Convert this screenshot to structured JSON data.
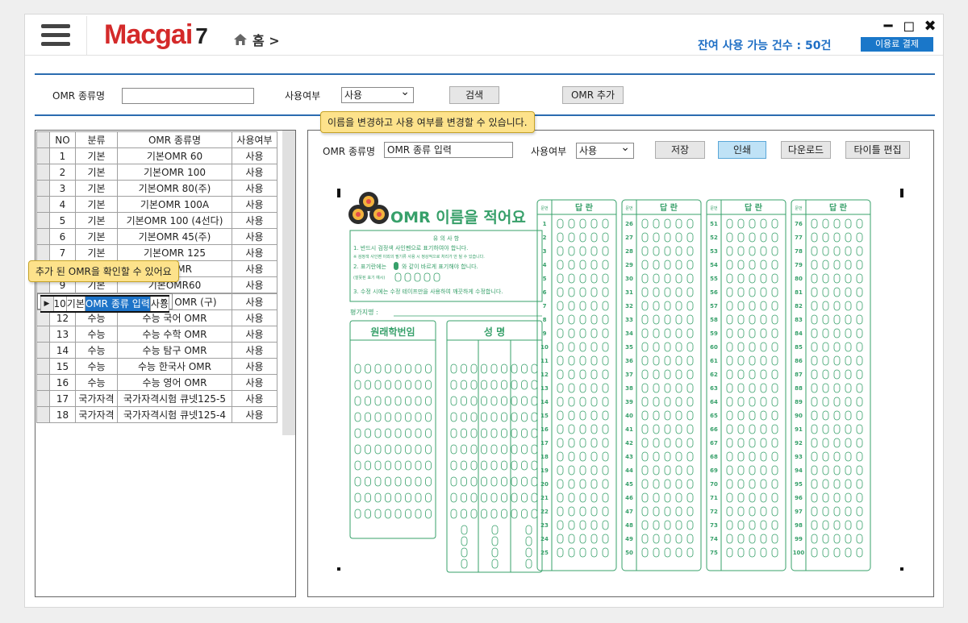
{
  "header": {
    "logo_main": "Macgai",
    "logo_num": "7",
    "breadcrumb": "홈 >",
    "remaining": "잔여 사용 가능 건수 : 50건",
    "pay_button": "이용료 결제"
  },
  "window_controls": {
    "min": "━",
    "max": "◻",
    "close": "✖"
  },
  "search": {
    "name_label": "OMR 종류명",
    "name_value": "",
    "use_label": "사용여부",
    "use_value": "사용",
    "search_button": "검색",
    "add_button": "OMR 추가"
  },
  "table": {
    "headers": [
      "NO",
      "분류",
      "OMR 종류명",
      "사용여부"
    ],
    "rows": [
      [
        "1",
        "기본",
        "기본OMR 60",
        "사용"
      ],
      [
        "2",
        "기본",
        "기본OMR 100",
        "사용"
      ],
      [
        "3",
        "기본",
        "기본OMR 80(주)",
        "사용"
      ],
      [
        "4",
        "기본",
        "기본OMR 100A",
        "사용"
      ],
      [
        "5",
        "기본",
        "기본OMR 100 (4선다)",
        "사용"
      ],
      [
        "6",
        "기본",
        "기본OMR 45(주)",
        "사용"
      ],
      [
        "7",
        "기본",
        "기본OMR 125",
        "사용"
      ],
      [
        "8",
        "기본",
        "한 OMR",
        "사용"
      ],
      [
        "9",
        "기본",
        "기본OMR60",
        "사용"
      ],
      [
        "10",
        "기본",
        "OMR 종류 입력",
        "사용"
      ],
      [
        "11",
        "수능",
        "수능 수학 OMR (구)",
        "사용"
      ],
      [
        "12",
        "수능",
        "수능 국어 OMR",
        "사용"
      ],
      [
        "13",
        "수능",
        "수능 수학 OMR",
        "사용"
      ],
      [
        "14",
        "수능",
        "수능 탐구 OMR",
        "사용"
      ],
      [
        "15",
        "수능",
        "수능 한국사 OMR",
        "사용"
      ],
      [
        "16",
        "수능",
        "수능 영어 OMR",
        "사용"
      ],
      [
        "17",
        "국가자격",
        "국가자격시험 큐넷125-5",
        "사용"
      ],
      [
        "18",
        "국가자격",
        "국가자격시험 큐넷125-4",
        "사용"
      ]
    ],
    "selected_row_marker": "▶"
  },
  "editor": {
    "name_label": "OMR 종류명",
    "name_value": "OMR 종류 입력",
    "use_label": "사용여부",
    "use_value": "사용",
    "save_button": "저장",
    "print_button": "인쇄",
    "download_button": "다운로드",
    "title_edit_button": "타이틀 편집"
  },
  "tooltips": {
    "top": "이름을 변경하고 사용 여부를 변경할 수 있습니다.",
    "left": "추가 된 OMR을 확인할 수 있어요"
  },
  "omr_sheet": {
    "title": "OMR 이름을 적어요",
    "notice_title": "유 의 사 항",
    "notice_1": "1. 반드시 검정색 사인펜으로 표기하여야 합니다.",
    "notice_1b": "※ 검정색 사인펜 이외의 필기류 사용 시 정상적으로 처리가 안 될 수 있습니다.",
    "notice_2a": "2. 표기란에는",
    "notice_2b": "와 같이 바르게 표기해야 합니다.",
    "notice_2c": "(잘못된 표기 예시)",
    "notice_3": "3. 수정 시에는 수정 테이프만을 사용하여 깨끗하게 수정합니다.",
    "evaluator": "평가지명 :",
    "id_title": "원래학번임",
    "name_title": "성      명",
    "answer_header": "답 란",
    "qnum_header": "문번"
  },
  "colors": {
    "accent": "#1d73c8",
    "omr_green": "#37a06a",
    "logo_red": "#d42a2a"
  }
}
